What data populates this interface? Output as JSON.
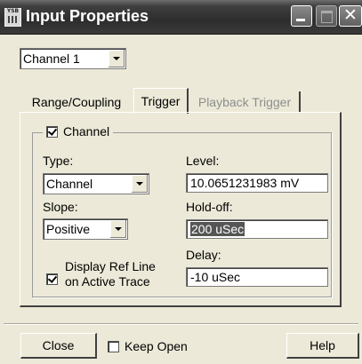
{
  "window": {
    "title": "Input Properties",
    "icon_text": "YSB",
    "buttons": {
      "close_glyph": "✕"
    }
  },
  "channel_select": {
    "value": "Channel 1"
  },
  "tabs": [
    {
      "label": "Range/Coupling",
      "state": "normal"
    },
    {
      "label": "Trigger",
      "state": "selected"
    },
    {
      "label": "Playback Trigger",
      "state": "disabled"
    }
  ],
  "trigger": {
    "channel_checkbox": {
      "label": "Channel",
      "checked": true
    },
    "type": {
      "label": "Type:",
      "value": "Channel"
    },
    "slope": {
      "label": "Slope:",
      "value": "Positive"
    },
    "level": {
      "label": "Level:",
      "value": "10.0651231983 mV"
    },
    "holdoff": {
      "label": "Hold-off:",
      "value": "200 uSec"
    },
    "delay": {
      "label": "Delay:",
      "value": "-10 uSec"
    },
    "display_ref": {
      "label_line1": "Display Ref Line",
      "label_line2": "on Active Trace",
      "checked": true
    }
  },
  "footer": {
    "close_label": "Close",
    "keep_open_label": "Keep Open",
    "keep_open_checked": false,
    "help_label": "Help"
  }
}
